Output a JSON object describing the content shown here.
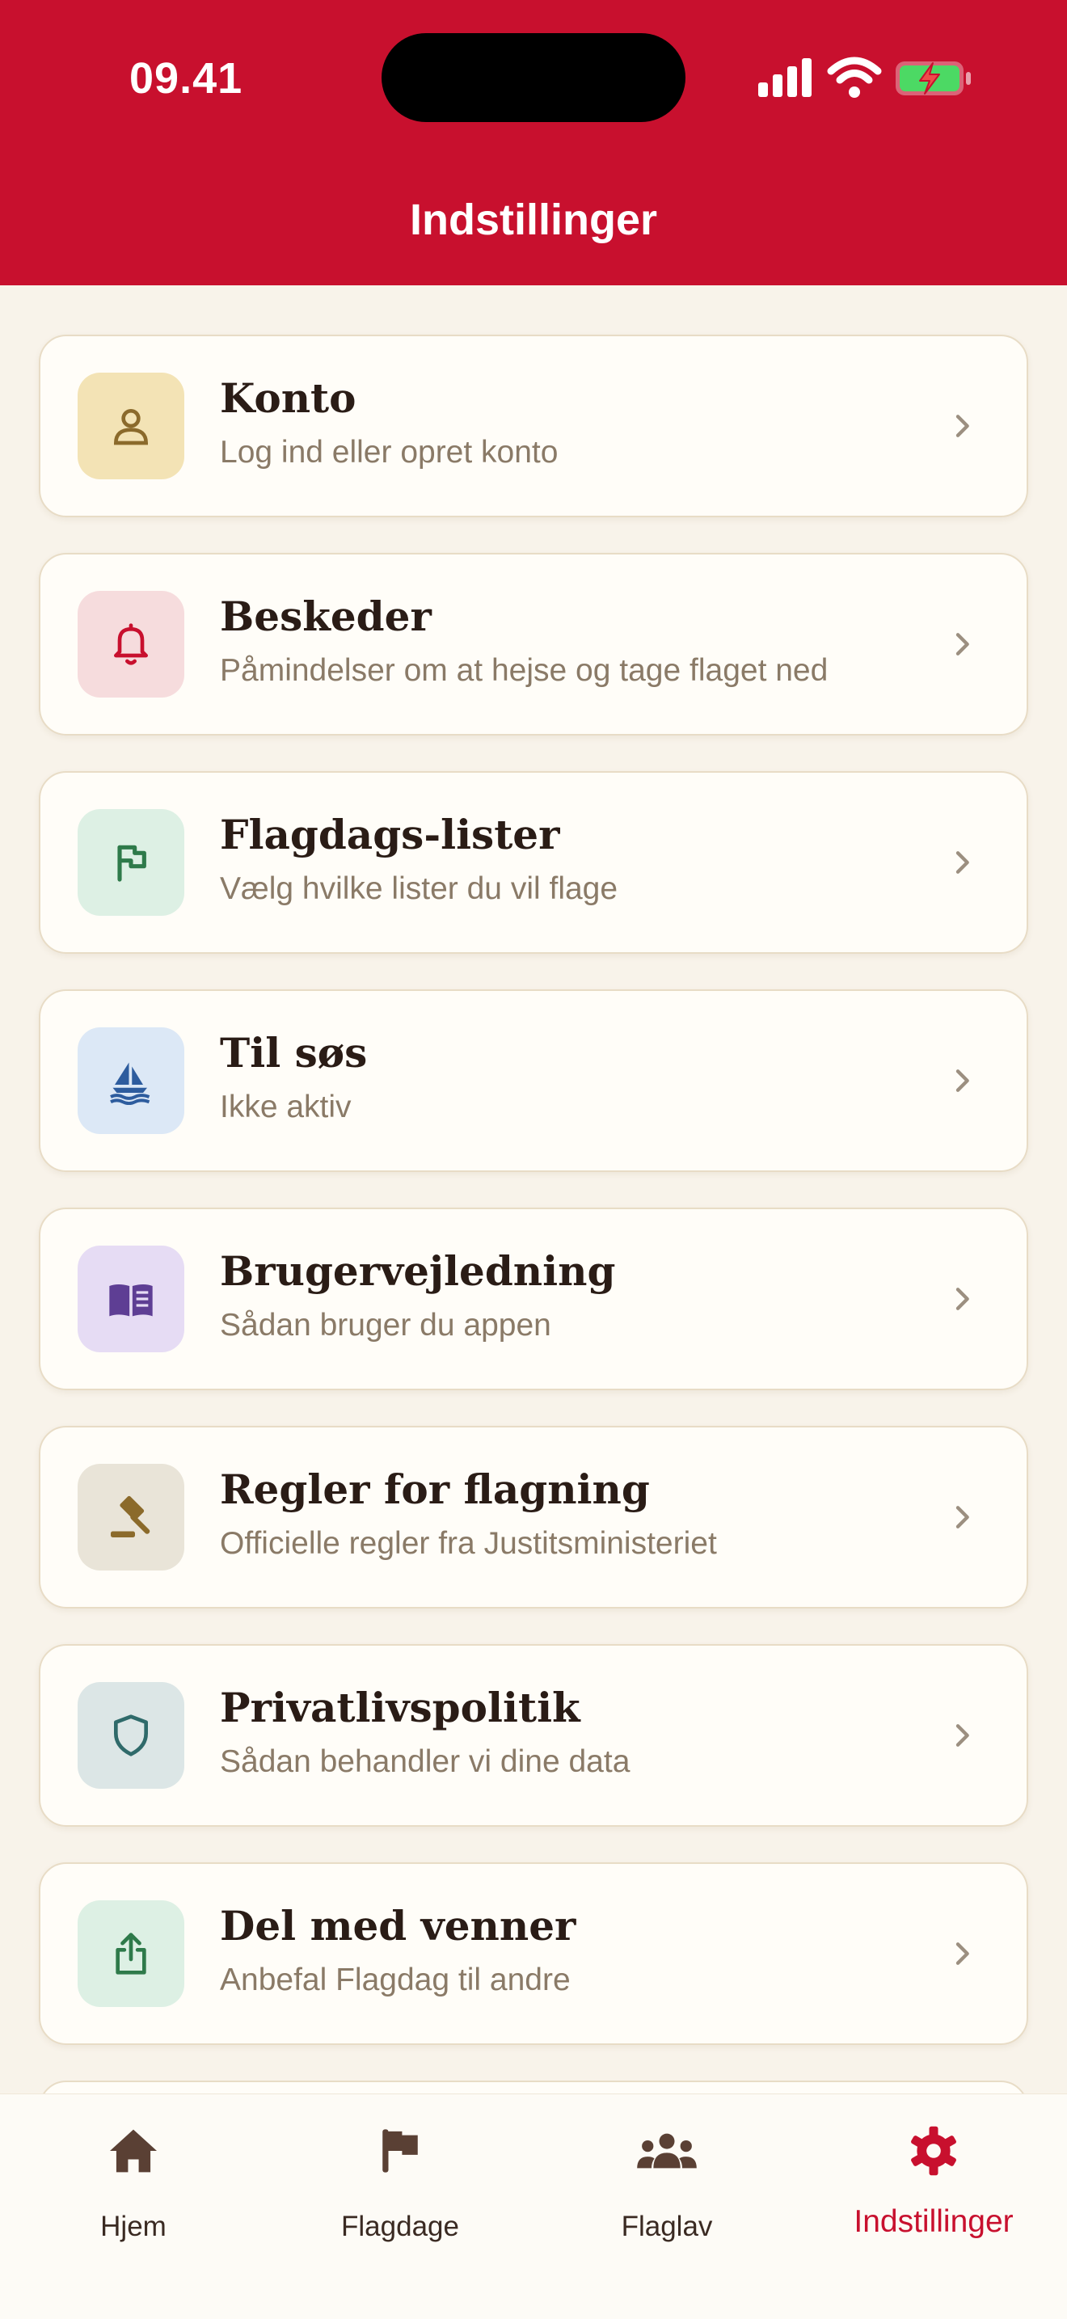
{
  "status_bar": {
    "time": "09.41"
  },
  "header": {
    "title": "Indstillinger"
  },
  "items": [
    {
      "title": "Konto",
      "subtitle": "Log ind eller opret konto",
      "icon": "user-icon",
      "icon_bg": "#F3E3B5",
      "icon_color": "#8B6A2B"
    },
    {
      "title": "Beskeder",
      "subtitle": "Påmindelser om at hejse og tage flaget ned",
      "icon": "bell-icon",
      "icon_bg": "#F6DCDD",
      "icon_color": "#C8102E"
    },
    {
      "title": "Flagdags-lister",
      "subtitle": "Vælg hvilke lister du vil flage",
      "icon": "flag-icon",
      "icon_bg": "#DDF0E4",
      "icon_color": "#2E7A4A"
    },
    {
      "title": "Til søs",
      "subtitle": "Ikke aktiv",
      "icon": "sailboat-icon",
      "icon_bg": "#DCE8F6",
      "icon_color": "#2D5C9E"
    },
    {
      "title": "Brugervejledning",
      "subtitle": "Sådan bruger du appen",
      "icon": "book-icon",
      "icon_bg": "#E6DCF4",
      "icon_color": "#5E3E94"
    },
    {
      "title": "Regler for flagning",
      "subtitle": "Officielle regler fra Justitsministeriet",
      "icon": "gavel-icon",
      "icon_bg": "#E9E4D8",
      "icon_color": "#8B6A2B"
    },
    {
      "title": "Privatlivspolitik",
      "subtitle": "Sådan behandler vi dine data",
      "icon": "shield-icon",
      "icon_bg": "#DCE6E6",
      "icon_color": "#2F6A6A"
    },
    {
      "title": "Del med venner",
      "subtitle": "Anbefal Flagdag til andre",
      "icon": "share-icon",
      "icon_bg": "#DDF0E4",
      "icon_color": "#2E7A4A"
    }
  ],
  "tabs": [
    {
      "label": "Hjem",
      "icon": "home-icon",
      "active": false
    },
    {
      "label": "Flagdage",
      "icon": "flag-icon",
      "active": false
    },
    {
      "label": "Flaglav",
      "icon": "people-icon",
      "active": false
    },
    {
      "label": "Indstillinger",
      "icon": "gear-icon",
      "active": true
    }
  ],
  "colors": {
    "accent": "#C8102E",
    "background": "#F8F3EA",
    "card": "#FFFDF8",
    "text": "#2A1C16",
    "muted": "#8A7A67"
  }
}
